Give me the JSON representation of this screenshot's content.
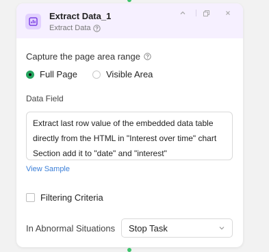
{
  "node": {
    "title": "Extract Data_1",
    "subtitle": "Extract Data"
  },
  "header_icons": [
    "chart-icon",
    "chevron-up-icon",
    "copy-icon",
    "close-icon"
  ],
  "capture": {
    "label": "Capture the page area range",
    "options": [
      {
        "label": "Full Page",
        "selected": true
      },
      {
        "label": "Visible Area",
        "selected": false
      }
    ]
  },
  "data_field": {
    "label": "Data Field",
    "value": "Extract last row value of the embedded data table directly from the HTML in \"Interest over time\" chart Section add it to \"date\" and \"interest\"",
    "view_sample": "View Sample"
  },
  "filtering": {
    "label": "Filtering Criteria",
    "checked": false
  },
  "abnormal": {
    "label": "In Abnormal Situations",
    "selected": "Stop Task"
  },
  "colors": {
    "accent": "#25a55f",
    "header_bg": "#f6f0ff",
    "icon_bg": "#e3d2ff",
    "icon_fg": "#7b3fe4",
    "link": "#3b7fd8"
  }
}
